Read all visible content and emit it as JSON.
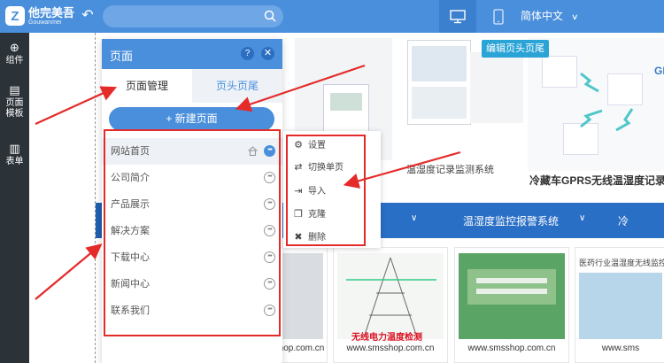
{
  "app": {
    "logo_cn": "他完美吾",
    "logo_en": "Gouwanmei"
  },
  "colors": {
    "brand": "#4a8fdc",
    "sidebar": "#2b3238",
    "annotation": "#e52a2a"
  },
  "header": {
    "language": "简体中文"
  },
  "sidebar": {
    "items": [
      {
        "label": "组件",
        "icon": "plus-circle-icon"
      },
      {
        "label": "页面模板",
        "icon": "document-icon"
      },
      {
        "label": "表单",
        "icon": "clipboard-icon"
      }
    ]
  },
  "canvas": {
    "edit_header_footer": "编辑页头页尾",
    "caption_recorder": "温湿度记录监测系统",
    "caption_truck": "冷藏车GPRS无线温湿度记录",
    "caption_gprs": "GPI",
    "nav_items": [
      "温湿度监控报警系统",
      "冷"
    ],
    "products": [
      {
        "url": "shop.com.cn",
        "caption": ""
      },
      {
        "url": "www.smsshop.com.cn",
        "caption": "无线电力温度检测"
      },
      {
        "url": "www.smsshop.com.cn",
        "caption": ""
      },
      {
        "url": "www.sms",
        "caption": "医药行业温湿度无线监控系"
      }
    ]
  },
  "panel": {
    "title": "页面",
    "help": "?",
    "tabs": [
      "页面管理",
      "页头页尾"
    ],
    "new_page": "+ 新建页面",
    "pages": [
      "网站首页",
      "公司简介",
      "产品展示",
      "解决方案",
      "下载中心",
      "新闻中心",
      "联系我们"
    ]
  },
  "context_menu": {
    "items": [
      {
        "label": "设置",
        "icon": "gear-icon"
      },
      {
        "label": "切换单页",
        "icon": "shuffle-icon"
      },
      {
        "label": "导入",
        "icon": "import-icon"
      },
      {
        "label": "克隆",
        "icon": "clone-icon"
      },
      {
        "label": "删除",
        "icon": "trash-icon"
      }
    ]
  }
}
